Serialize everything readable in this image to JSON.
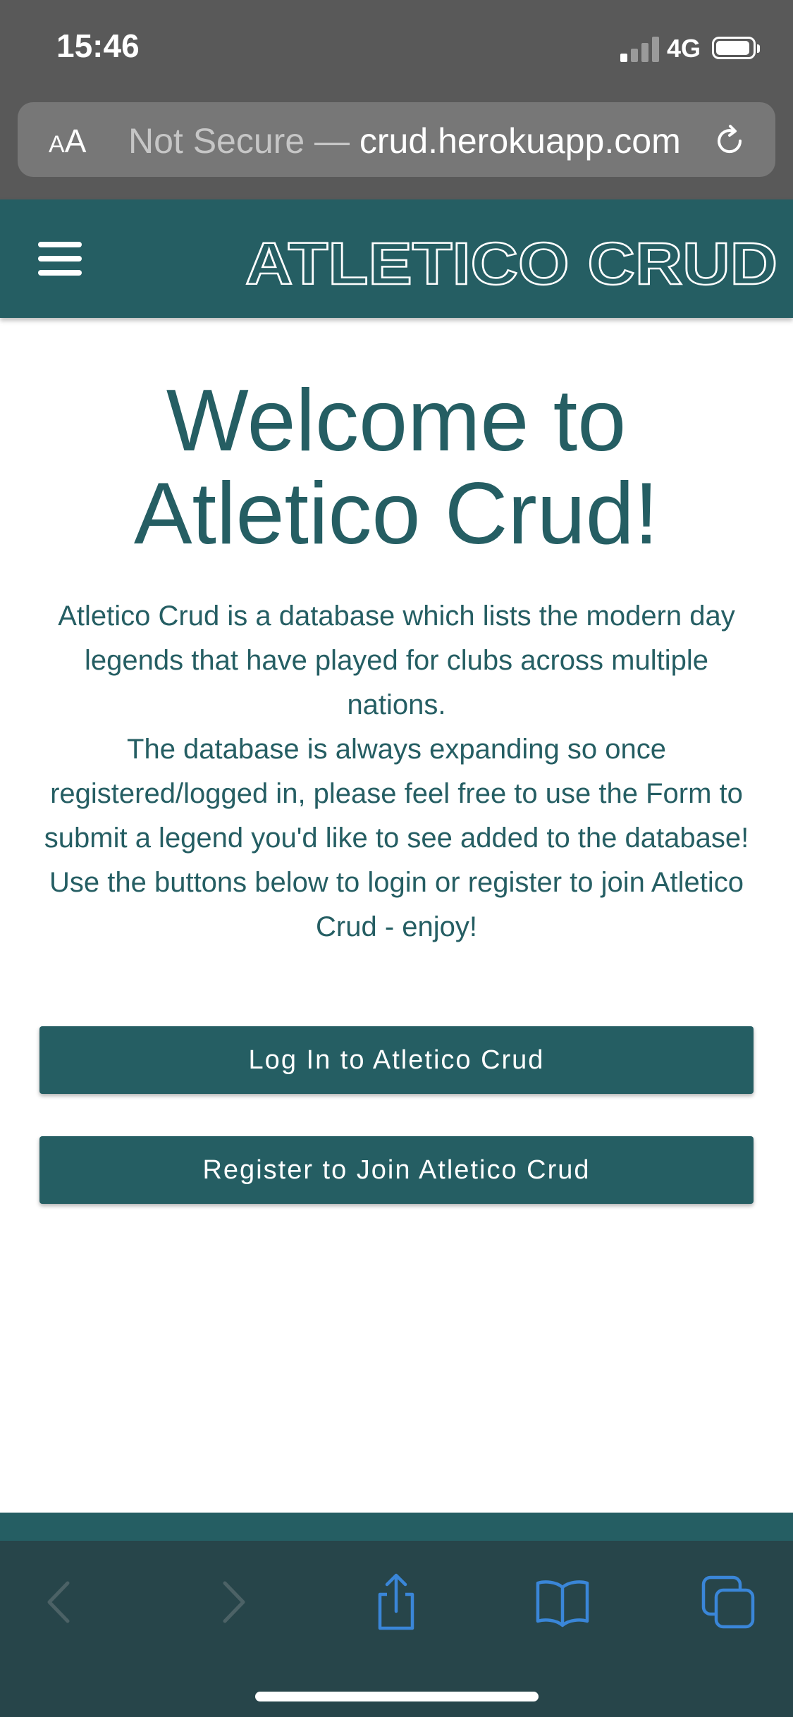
{
  "status_bar": {
    "time": "15:46",
    "network": "4G",
    "signal_bars_active": 1,
    "signal_bars_total": 4
  },
  "browser": {
    "aa_label_small": "A",
    "aa_label_large": "A",
    "url_prefix": "Not Secure — ",
    "url_text": "crud.herokuapp.com",
    "reload_icon": "reload-icon"
  },
  "site": {
    "brand": "ATLETICO CRUD",
    "menu_icon": "hamburger-menu-icon",
    "colors": {
      "primary": "#255e63",
      "toolbar": "#27454a",
      "icon_blue": "#3a86d8"
    }
  },
  "main": {
    "title": "Welcome to Atletico Crud!",
    "paragraphs": [
      "Atletico Crud is a database which lists the modern day legends that have played for clubs across multiple nations.",
      "The database is always expanding so once registered/logged in, please feel free to use the Form to submit a legend you'd like to see added to the database!",
      "Use the buttons below to login or register to join Atletico Crud - enjoy!"
    ],
    "login_button": "Log In to Atletico Crud",
    "register_button": "Register to Join Atletico Crud"
  },
  "toolbar": {
    "back_icon": "chevron-left-icon",
    "forward_icon": "chevron-right-icon",
    "share_icon": "share-icon",
    "bookmarks_icon": "book-icon",
    "tabs_icon": "tabs-icon"
  }
}
